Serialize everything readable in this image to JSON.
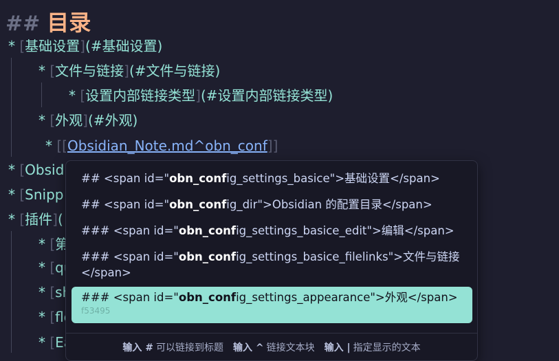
{
  "heading": {
    "hash": "##",
    "text": "目录"
  },
  "toc": [
    {
      "bullet": "*",
      "text": "基础设置",
      "anchor": "(#基础设置)"
    },
    {
      "bullet": "*",
      "text": "文件与链接",
      "anchor": "(#文件与链接)"
    },
    {
      "bullet": "*",
      "text": "设置内部链接类型",
      "anchor": "(#设置内部链接类型)"
    },
    {
      "bullet": "*",
      "text": "外观",
      "anchor": "(#外观)"
    },
    {
      "bullet": "*",
      "open": "[[",
      "text": "Obsidian_Note.md^obn_conf",
      "close": "]]"
    },
    {
      "bullet": "*",
      "text": "Obsid"
    },
    {
      "bullet": "*",
      "text": "Snipp"
    },
    {
      "bullet": "*",
      "text": "插件",
      "anchor": "("
    },
    {
      "bullet": "*",
      "text": "第"
    },
    {
      "bullet": "*",
      "text": "qu"
    },
    {
      "bullet": "*",
      "text": "sh"
    },
    {
      "bullet": "*",
      "text": "flo"
    },
    {
      "bullet": "*",
      "text": "Ea"
    }
  ],
  "suggestions": [
    {
      "pre": "## <span id=\"",
      "bold": "obn_conf",
      "post": "ig_settings_basice\">基础设置</span>"
    },
    {
      "pre": "## <span id=\"",
      "bold": "obn_conf",
      "post": "ig_dir\">Obsidian 的配置目录</span>"
    },
    {
      "pre": "### <span id=\"",
      "bold": "obn_conf",
      "post": "ig_settings_basice_edit\">编辑</span>"
    },
    {
      "pre": "### <span id=\"",
      "bold": "obn_conf",
      "post": "ig_settings_basice_filelinks\">文件与链接",
      "post2": "</span>"
    },
    {
      "pre": "### <span id=\"",
      "bold": "obn_conf",
      "post": "ig_settings_appearance\">外观</span>",
      "sub": "f53495"
    }
  ],
  "footer": {
    "hint1_key": "输入 #",
    "hint1_text": "可以链接到标题",
    "hint2_key": "输入 ^",
    "hint2_text": "链接文本块",
    "hint3_key": "输入 |",
    "hint3_text": "指定显示的文本"
  }
}
